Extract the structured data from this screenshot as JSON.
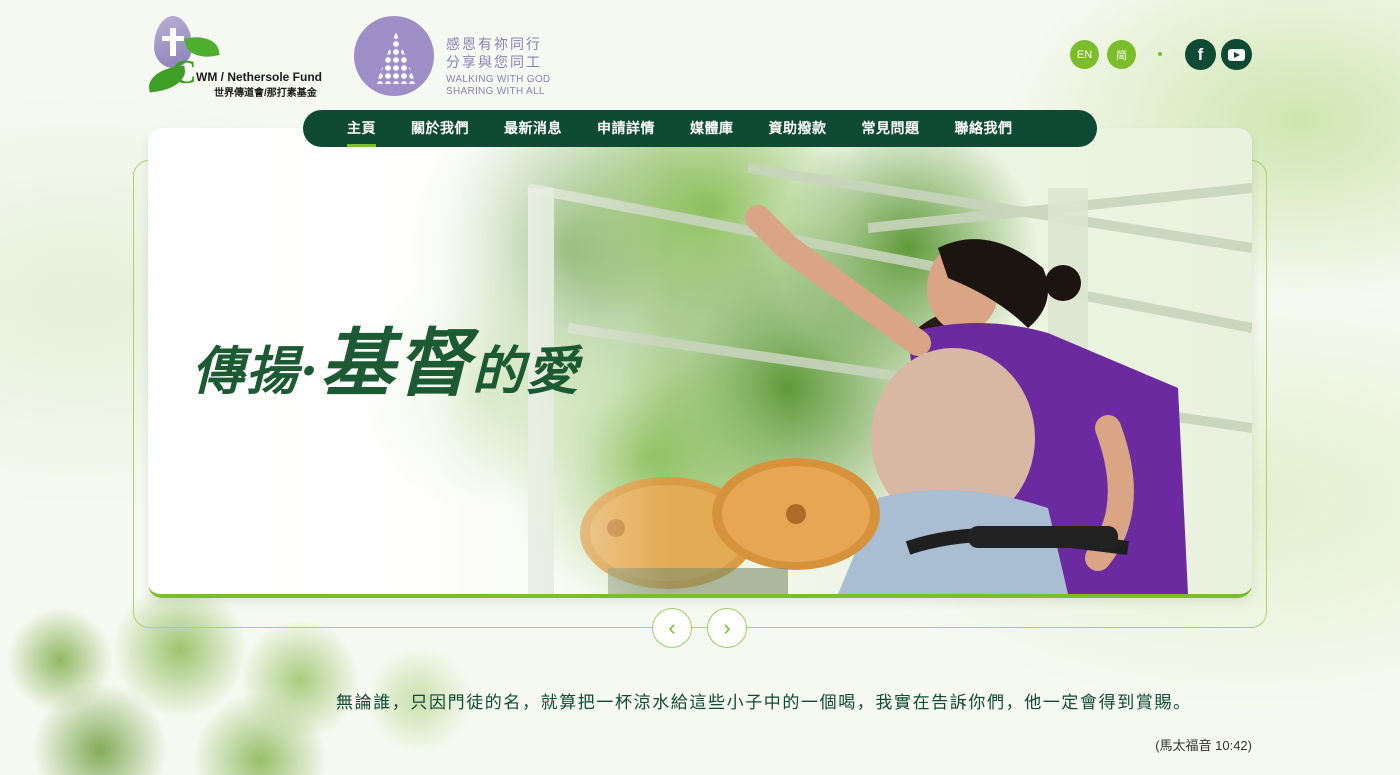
{
  "logos": {
    "cwm": {
      "name_en": "WM / Nethersole Fund",
      "name_zh": "世界傳道會/那打素基金",
      "c_letter": "C"
    },
    "walking": {
      "zh_line1": "感恩有祢同行",
      "zh_line2": "分享與您同工",
      "en_line1": "WALKING  WITH GOD",
      "en_line2": "SHARING WITH ALL"
    }
  },
  "header": {
    "lang_en": "EN",
    "lang_sc": "简",
    "facebook_glyph": "f",
    "icons": [
      "facebook-icon",
      "youtube-icon"
    ]
  },
  "nav": {
    "items": [
      {
        "label": "主頁",
        "active": true
      },
      {
        "label": "關於我們"
      },
      {
        "label": "最新消息"
      },
      {
        "label": "申請詳情"
      },
      {
        "label": "媒體庫"
      },
      {
        "label": "資助撥款"
      },
      {
        "label": "常見問題"
      },
      {
        "label": "聯絡我們"
      }
    ]
  },
  "banner": {
    "slogan_part1": "傳揚·",
    "slogan_part2": "基督",
    "slogan_part3": "的愛"
  },
  "slider_controls": {
    "prev_glyph": "‹",
    "next_glyph": "›"
  },
  "verse": {
    "text": "無論誰，只因門徒的名，就算把一杯涼水給這些小子中的一個喝，我實在告訴你們，他一定會得到賞賜。",
    "reference": "(馬太福音 10:42)"
  },
  "colors": {
    "nav_bg": "#0f4a34",
    "accent": "#7bbd2a",
    "purple": "#9e8fc8"
  }
}
